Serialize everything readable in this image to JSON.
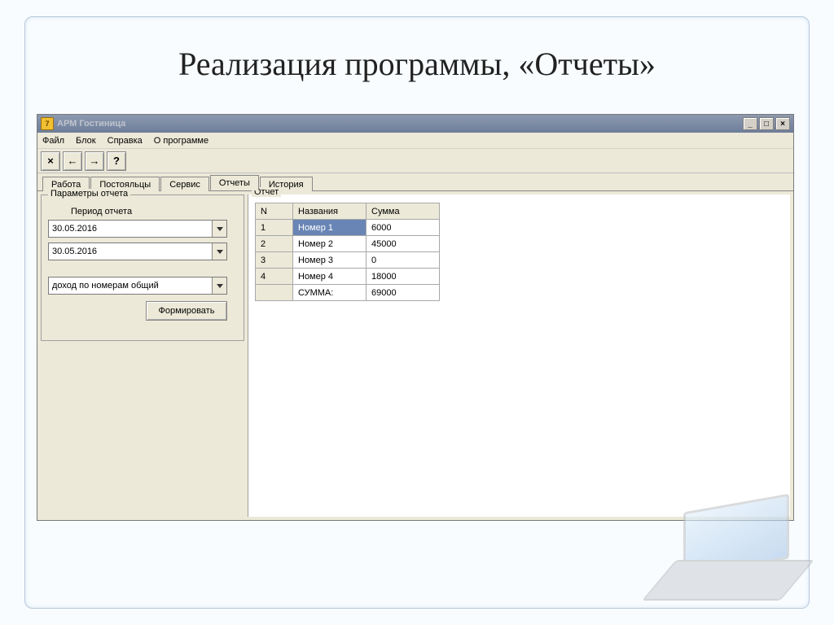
{
  "slide": {
    "title": "Реализация программы, «Отчеты»"
  },
  "window": {
    "title": "АРМ Гостиница",
    "menu": [
      "Файл",
      "Блок",
      "Справка",
      "О программе"
    ],
    "toolbar_icons": [
      "×",
      "←",
      "→",
      "?"
    ],
    "tabs": [
      {
        "label": "Работа",
        "active": false
      },
      {
        "label": "Постояльцы",
        "active": false
      },
      {
        "label": "Сервис",
        "active": false
      },
      {
        "label": "Отчеты",
        "active": true
      },
      {
        "label": "История",
        "active": false
      }
    ]
  },
  "params": {
    "group_title": "Параметры отчета",
    "period_label": "Период отчета",
    "date_from": "30.05.2016",
    "date_to": "30.05.2016",
    "report_type": "доход по номерам общий",
    "submit_label": "Формировать"
  },
  "report": {
    "group_title": "Отчет",
    "columns": [
      "N",
      "Названия",
      "Сумма"
    ],
    "rows": [
      {
        "n": "1",
        "name": "Номер 1",
        "sum": "6000",
        "selected": true
      },
      {
        "n": "2",
        "name": "Номер 2",
        "sum": "45000",
        "selected": false
      },
      {
        "n": "3",
        "name": "Номер 3",
        "sum": "0",
        "selected": false
      },
      {
        "n": "4",
        "name": "Номер 4",
        "sum": "18000",
        "selected": false
      }
    ],
    "total_label": "СУММА:",
    "total_value": "69000"
  }
}
